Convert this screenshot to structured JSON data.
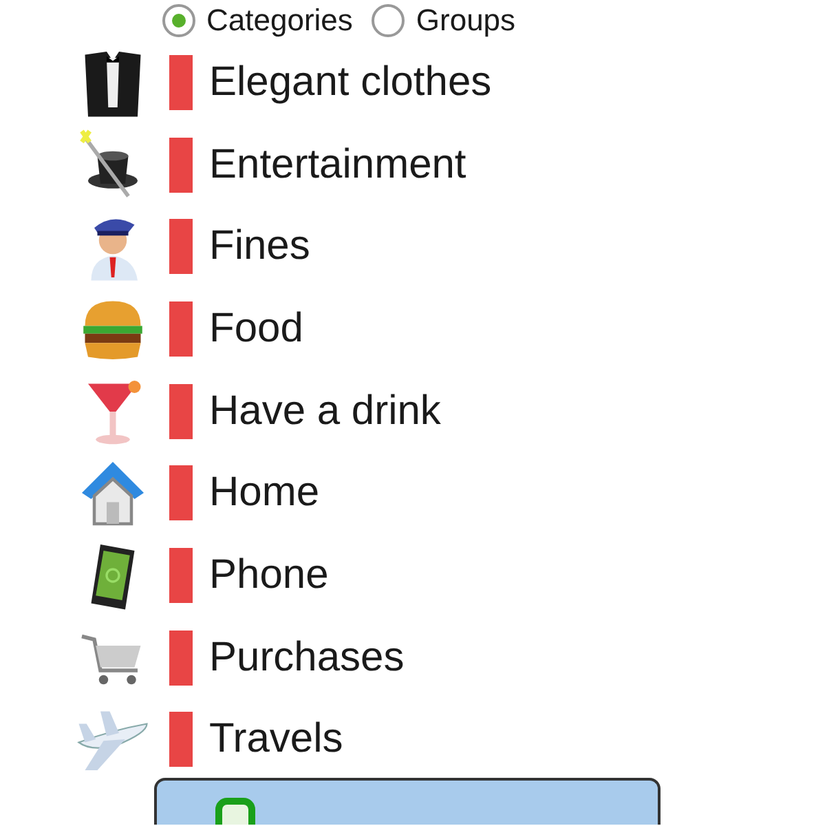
{
  "view_mode": [
    {
      "label": "Categories",
      "selected": true
    },
    {
      "label": "Groups",
      "selected": false
    }
  ],
  "categories": [
    {
      "name": "Elegant clothes",
      "color": "#e84545"
    },
    {
      "name": "Entertainment",
      "color": "#e84545"
    },
    {
      "name": "Fines",
      "color": "#e84545"
    },
    {
      "name": "Food",
      "color": "#e84545"
    },
    {
      "name": "Have a drink",
      "color": "#e84545"
    },
    {
      "name": "Home",
      "color": "#e84545"
    },
    {
      "name": "Phone",
      "color": "#e84545"
    },
    {
      "name": "Purchases",
      "color": "#e84545"
    },
    {
      "name": "Travels",
      "color": "#e84545"
    }
  ]
}
